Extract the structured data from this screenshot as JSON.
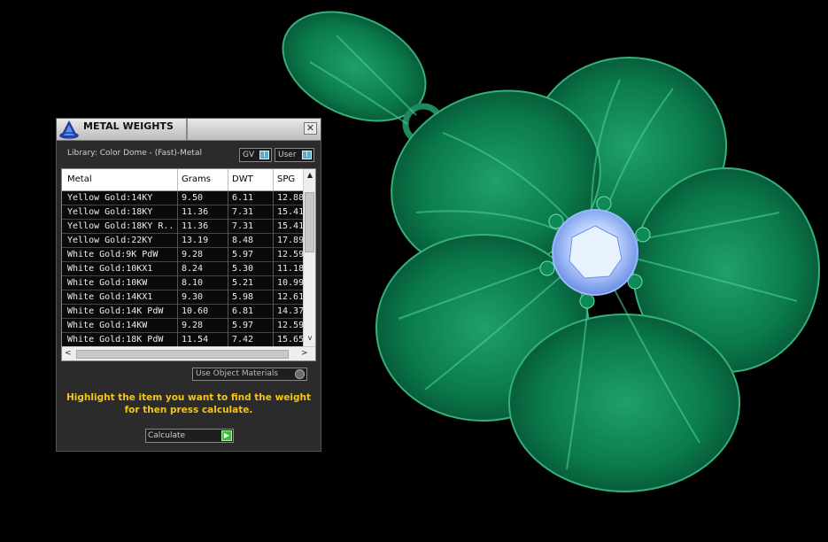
{
  "panel": {
    "title": "METAL WEIGHTS",
    "close_glyph": "✕",
    "library_label": "Library: Color Dome - (Fast)-Metal",
    "gv_label": "GV",
    "user_label": "User",
    "toggle_glyph": "I",
    "columns": [
      "Metal",
      "Grams",
      "DWT",
      "SPG"
    ],
    "rows": [
      [
        "Yellow Gold:14KY",
        "9.50",
        "6.11",
        "12.88"
      ],
      [
        "Yellow Gold:18KY",
        "11.36",
        "7.31",
        "15.41"
      ],
      [
        "Yellow Gold:18KY R...",
        "11.36",
        "7.31",
        "15.41"
      ],
      [
        "Yellow Gold:22KY",
        "13.19",
        "8.48",
        "17.89"
      ],
      [
        "White Gold:9K PdW",
        "9.28",
        "5.97",
        "12.59"
      ],
      [
        "White Gold:10KX1",
        "8.24",
        "5.30",
        "11.18"
      ],
      [
        "White Gold:10KW",
        "8.10",
        "5.21",
        "10.99"
      ],
      [
        "White Gold:14KX1",
        "9.30",
        "5.98",
        "12.61"
      ],
      [
        "White Gold:14K PdW",
        "10.60",
        "6.81",
        "14.37"
      ],
      [
        "White Gold:14KW",
        "9.28",
        "5.97",
        "12.59"
      ],
      [
        "White Gold:18K PdW",
        "11.54",
        "7.42",
        "15.65"
      ]
    ],
    "use_object_materials": "Use Object Materials",
    "hint_line1": "Highlight the item you want to find the weight",
    "hint_line2": "for then press calculate.",
    "calculate_label": "Calculate",
    "scroll_up": "▲",
    "scroll_down": "v",
    "scroll_left": "<",
    "scroll_right": ">",
    "go_glyph": "▶"
  },
  "colors": {
    "background": "#000000",
    "pendant_green": "#0f7a52",
    "gem_blue": "#8fb4ff",
    "hint_yellow": "#f4c419"
  },
  "icons": [
    "app-logo-icon",
    "close-icon",
    "toggle-icon",
    "radio-icon",
    "play-icon"
  ]
}
